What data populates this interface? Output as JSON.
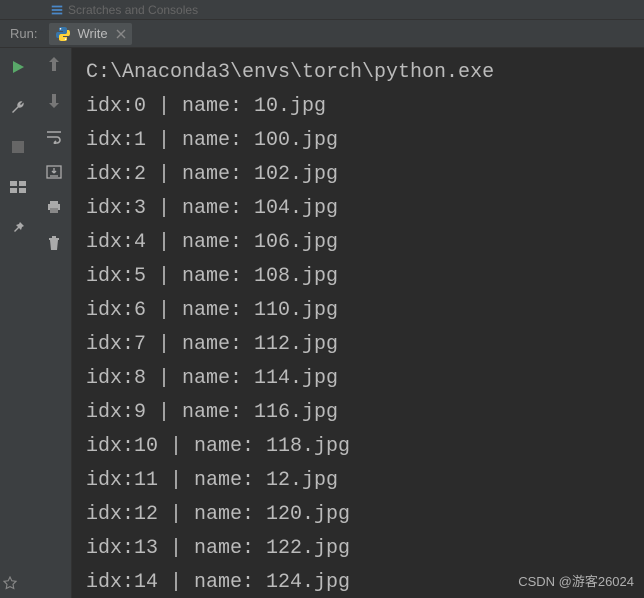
{
  "top": {
    "scratches": "Scratches and Consoles"
  },
  "run": {
    "label": "Run:",
    "tab_name": "Write"
  },
  "console": {
    "exec_path": "C:\\Anaconda3\\envs\\torch\\python.exe",
    "rows": [
      {
        "idx": 0,
        "name": "10.jpg"
      },
      {
        "idx": 1,
        "name": "100.jpg"
      },
      {
        "idx": 2,
        "name": "102.jpg"
      },
      {
        "idx": 3,
        "name": "104.jpg"
      },
      {
        "idx": 4,
        "name": "106.jpg"
      },
      {
        "idx": 5,
        "name": "108.jpg"
      },
      {
        "idx": 6,
        "name": "110.jpg"
      },
      {
        "idx": 7,
        "name": "112.jpg"
      },
      {
        "idx": 8,
        "name": "114.jpg"
      },
      {
        "idx": 9,
        "name": "116.jpg"
      },
      {
        "idx": 10,
        "name": "118.jpg"
      },
      {
        "idx": 11,
        "name": "12.jpg"
      },
      {
        "idx": 12,
        "name": "120.jpg"
      },
      {
        "idx": 13,
        "name": "122.jpg"
      },
      {
        "idx": 14,
        "name": "124.jpg"
      }
    ]
  },
  "watermark": "CSDN @游客26024"
}
